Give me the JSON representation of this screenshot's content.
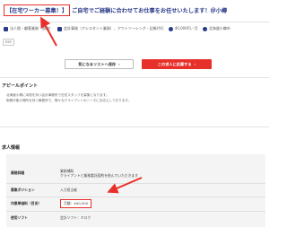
{
  "header": {
    "title_highlight": "【在宅ワーカー募集！】",
    "title_rest": "ご自宅でご経験に合わせてお仕事をお任せいたします！＠小樽"
  },
  "meta": {
    "items": [
      {
        "icon": "building-icon",
        "label": "法人税・顧客業務（税務）"
      },
      {
        "icon": "briefcase-icon",
        "label": "会計事務（アシスタント業務）、アウトソーシング・記帳代行"
      },
      {
        "icon": "yen-icon",
        "label": "40,000円／月"
      },
      {
        "icon": "location-icon",
        "label": "北海道小樽市"
      }
    ],
    "tag": "ESP"
  },
  "actions": {
    "save_label": "気になるリストへ保存",
    "apply_label": "この求人に応募する",
    "apply_arrow": "›"
  },
  "appeal": {
    "title": "アピールポイント",
    "lines": [
      "北海道小樽に本拠を持つ会計事務所で在宅スタッフを募集となります。",
      "勤務可能の場所を持つ事務所で、様々なクライアントのニーズにお応えしております。"
    ]
  },
  "job_info": {
    "title": "求人情報",
    "rows": [
      {
        "label": "業務詳細",
        "value": "業務補助\nクライアントと業務委託契約を結んでいただきます"
      },
      {
        "label": "募集ポジション",
        "value": "入力担当者"
      },
      {
        "label": "作業単価料（目安）",
        "value": "月額：¥40,000"
      },
      {
        "label": "使用ソフト",
        "value": "会計ソフト：ミロク"
      }
    ]
  },
  "colors": {
    "accent": "#e8302a",
    "navy": "#2a3a8a"
  }
}
